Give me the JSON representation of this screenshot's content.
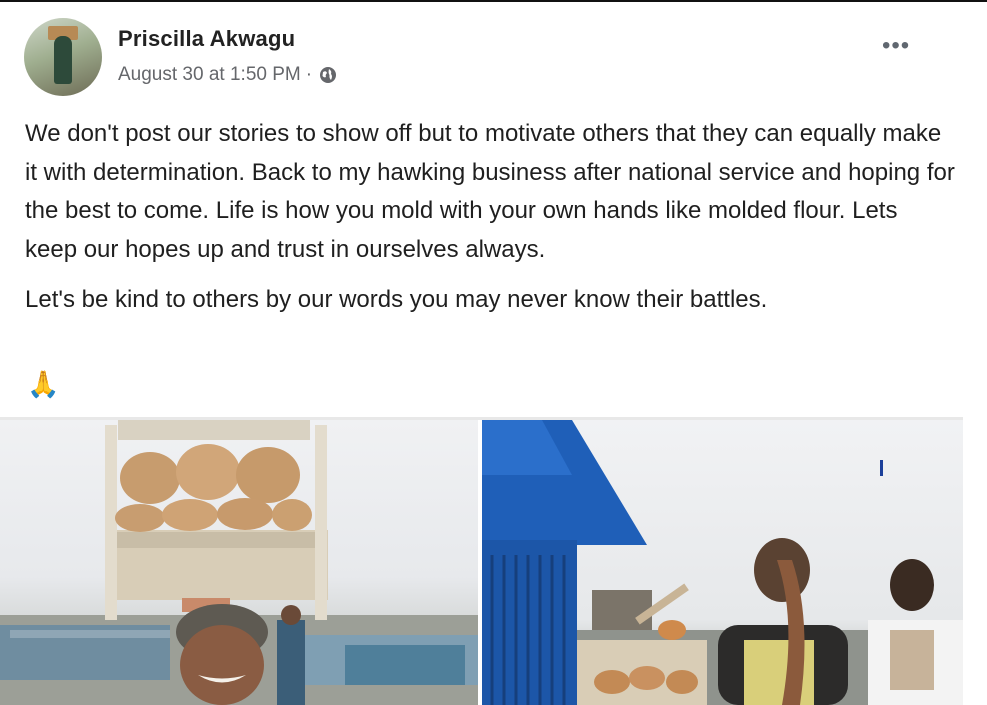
{
  "post": {
    "author": "Priscilla Akwagu",
    "timestamp": "August 30 at 1:50 PM",
    "separator": "·",
    "privacy_icon": "globe-icon",
    "more_icon": "more-options-icon",
    "more_label": "•••",
    "paragraphs": [
      "We don't post our stories to show off but to motivate others that they can equally make it with determination. Back to my hawking business after national service and hoping for the best to come. Life is how you mold with your own hands like molded flour. Lets keep our hopes up and trust in ourselves always.",
      "Let's be kind to others by our words you may never know their battles."
    ],
    "emoji": "🙏",
    "photos": [
      {
        "name": "photo-left",
        "subject": "woman carrying a wooden tray of bread on her head"
      },
      {
        "name": "photo-right",
        "subject": "two women beside a blue kiosk with a tray of bread"
      }
    ]
  },
  "colors": {
    "author_text": "#222222",
    "meta_text": "#65676b",
    "body_text": "#1f1f1f",
    "kiosk_blue": "#1f5fb8"
  }
}
